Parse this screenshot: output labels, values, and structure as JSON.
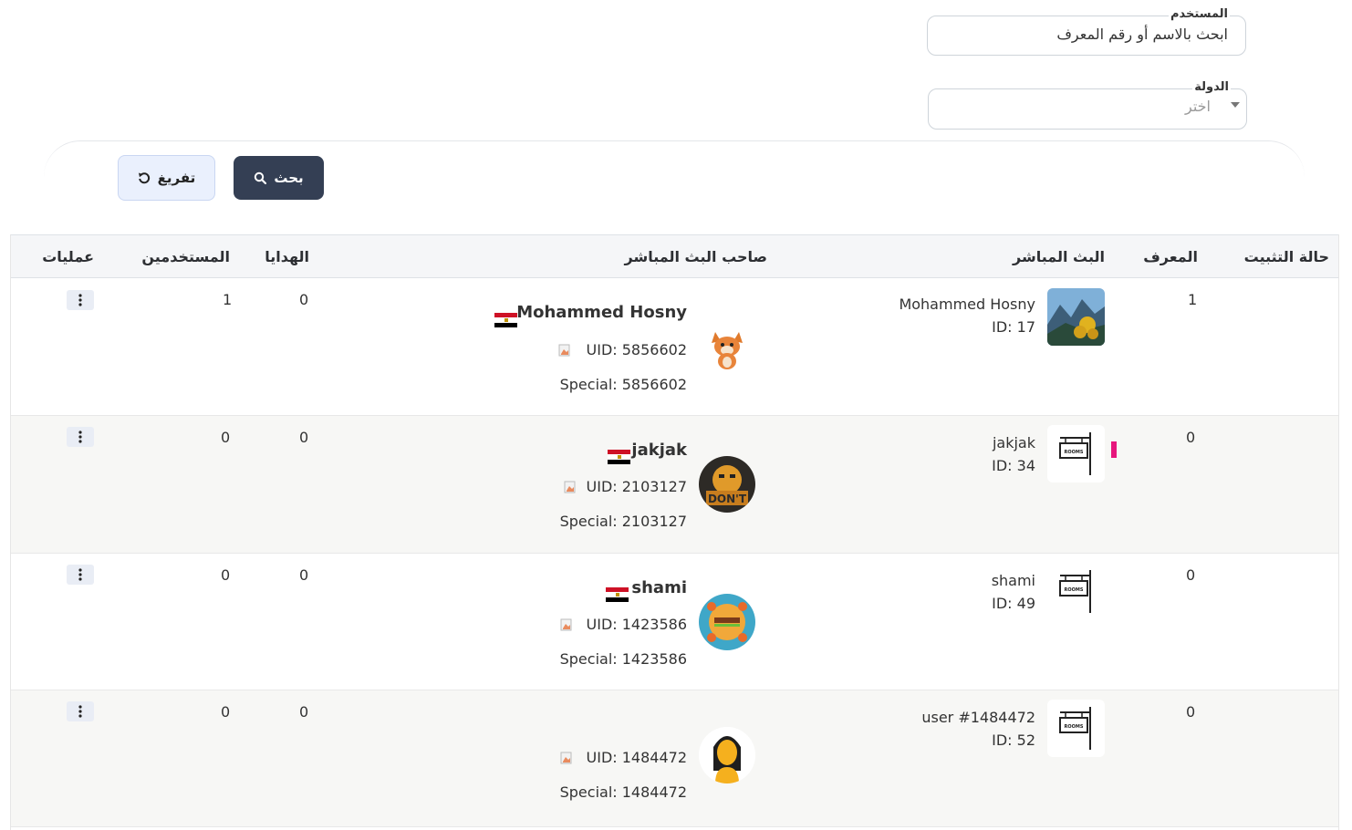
{
  "filters": {
    "user_label": "المستخدم",
    "user_value": "ابحث بالاسم أو رقم المعرف",
    "country_label": "الدولة",
    "country_placeholder": "اختر"
  },
  "buttons": {
    "search": "بحث",
    "reset": "تفريغ"
  },
  "table": {
    "headers": {
      "pin_status": "حالة التثبيت",
      "id": "المعرف",
      "stream": "البث المباشر",
      "owner": "صاحب البث المباشر",
      "gifts": "الهدايا",
      "users": "المستخدمين",
      "actions": "عمليات"
    },
    "rows": [
      {
        "id": "1",
        "stream_name": "Mohammed Hosny",
        "stream_id": "ID: 17",
        "owner_name": "Mohammed Hosny",
        "uid": "UID: 5856602",
        "special": "Special: 5856602",
        "gifts": "0",
        "users": "1",
        "thumb": "landscape-thumbnail",
        "avatar": "fox-avatar",
        "pinned": false,
        "flag": true
      },
      {
        "id": "0",
        "stream_name": "jakjak",
        "stream_id": "ID: 34",
        "owner_name": "jakjak",
        "uid": "UID: 2103127",
        "special": "Special: 2103127",
        "gifts": "0",
        "users": "0",
        "thumb": "rooms-sign-icon",
        "avatar": "cartoon-avatar",
        "pinned": true,
        "flag": true
      },
      {
        "id": "0",
        "stream_name": "shami",
        "stream_id": "ID: 49",
        "owner_name": "shami",
        "uid": "UID: 1423586",
        "special": "Special: 1423586",
        "gifts": "0",
        "users": "0",
        "thumb": "rooms-sign-icon",
        "avatar": "burger-avatar",
        "pinned": false,
        "flag": true
      },
      {
        "id": "0",
        "stream_name": "user #1484472",
        "stream_id": "ID: 52",
        "owner_name": "",
        "uid": "UID: 1484472",
        "special": "Special: 1484472",
        "gifts": "0",
        "users": "0",
        "thumb": "rooms-sign-icon",
        "avatar": "woman-silhouette-avatar",
        "pinned": false,
        "flag": false
      }
    ]
  },
  "colors": {
    "primary_button": "#343f54",
    "pin_marker": "#e7167d",
    "reset_button": "#eaf0fd"
  }
}
